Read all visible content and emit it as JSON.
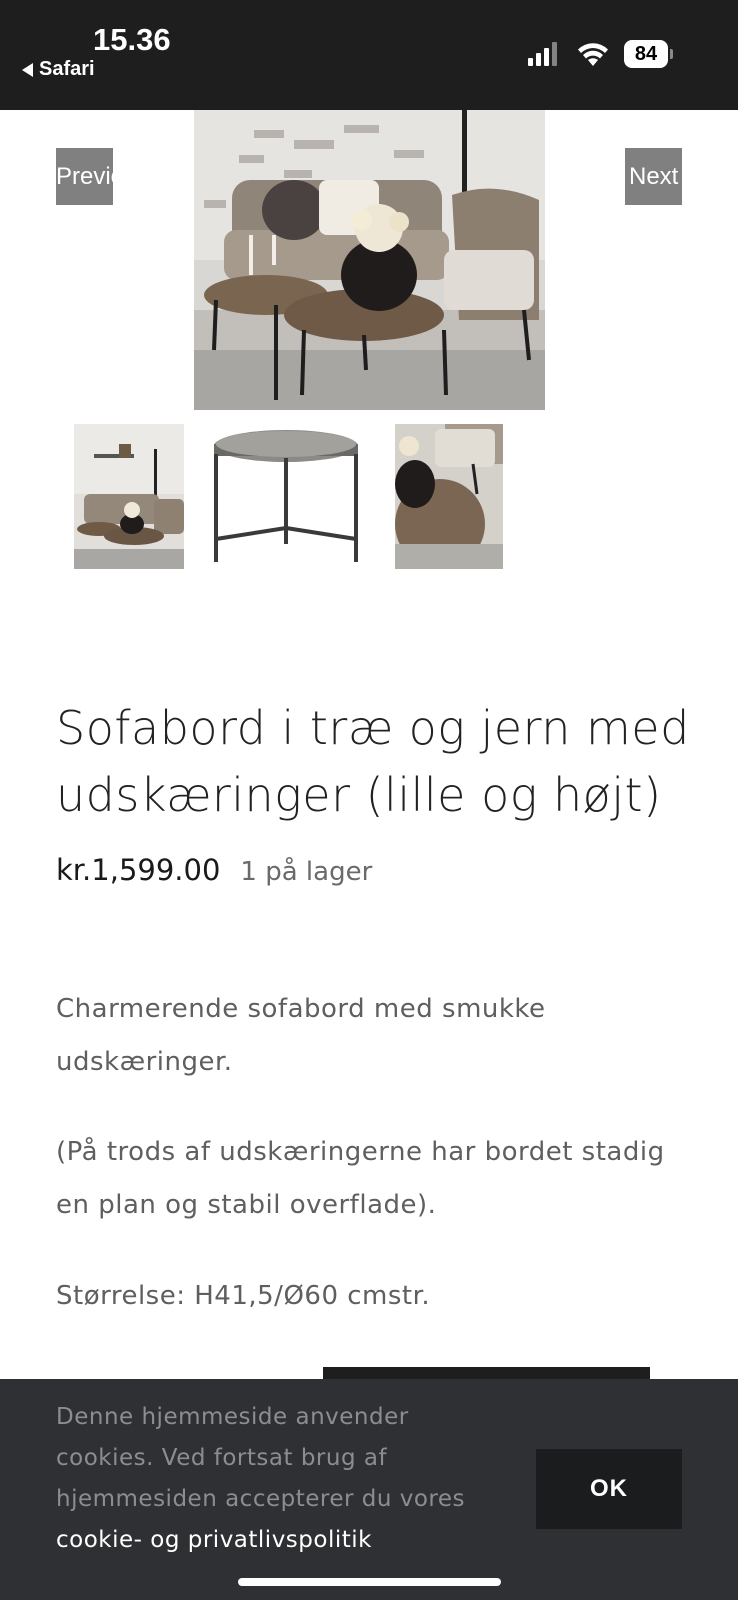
{
  "status_bar": {
    "time": "15.36",
    "back_app": "Safari",
    "battery": "84"
  },
  "gallery": {
    "prev_label": "Previous",
    "next_label": "Next"
  },
  "product": {
    "title": "Sofabord i træ og jern med udskæringer (lille og højt)",
    "price": "kr.1,599.00",
    "stock": "1 på lager",
    "description": [
      "Charmerende sofabord med smukke udskæringer.",
      "(På trods af udskæringerne har bordet stadig en plan og stabil overflade).",
      "Størrelse: H41,5/Ø60 cmstr."
    ]
  },
  "cookie_banner": {
    "text": "Denne hjemmeside anvender cookies. Ved fortsat brug af hjemmesiden accepterer du vores",
    "link_text": "cookie- og privatlivspolitik",
    "ok_label": "OK"
  }
}
